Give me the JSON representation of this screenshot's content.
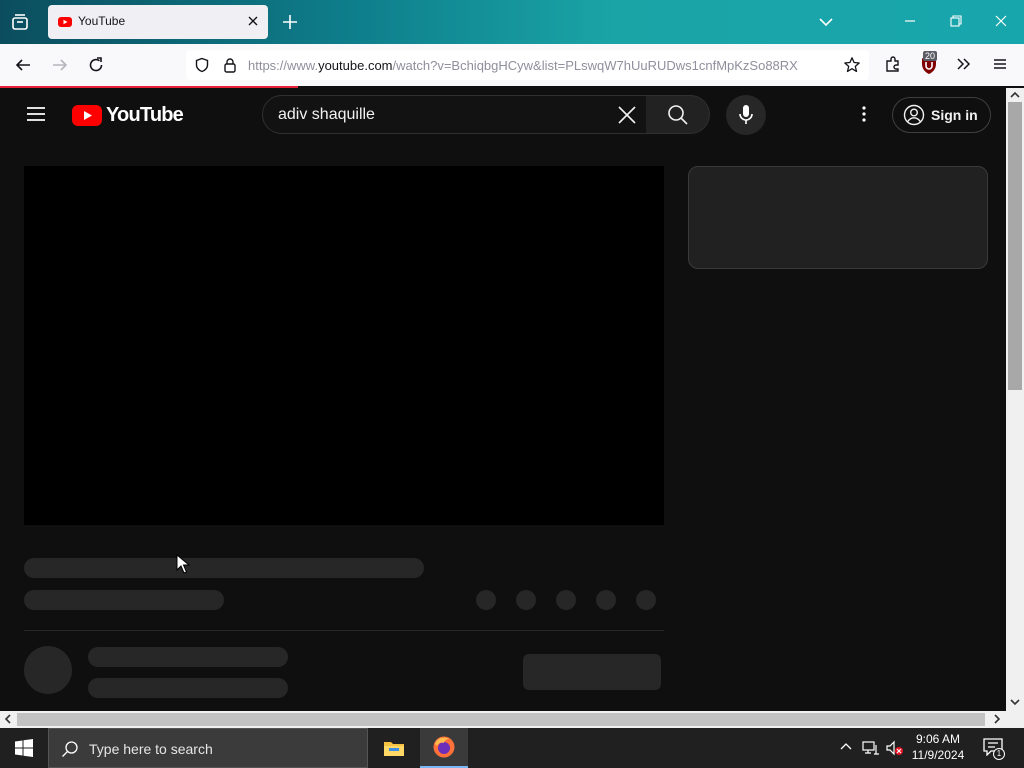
{
  "browser": {
    "tab": {
      "title": "YouTube"
    },
    "url": {
      "prefix": "https://www.",
      "domain": "youtube.com",
      "suffix": "/watch?v=BchiqbgHCyw&list=PLswqW7hUuRUDws1cnfMpKzSo88RX"
    },
    "ublock_count": "20"
  },
  "youtube": {
    "logo_text": "YouTube",
    "search": {
      "value": "adiv shaquille"
    },
    "sign_in_label": "Sign in"
  },
  "taskbar": {
    "search_placeholder": "Type here to search",
    "time": "9:06 AM",
    "date": "11/9/2024",
    "notification_count": "1"
  },
  "colors": {
    "accent_red": "#ff0000",
    "page_bg": "#0f0f0f",
    "skeleton": "#272727",
    "load_bar": "#e8203a"
  },
  "icons": [
    "tab-list-icon",
    "youtube-favicon",
    "close-icon",
    "plus-icon",
    "chevron-down-icon",
    "minimize-icon",
    "maximize-icon",
    "back-icon",
    "forward-icon",
    "reload-icon",
    "shield-icon",
    "lock-icon",
    "star-icon",
    "extensions-icon",
    "ublock-icon",
    "overflow-icon",
    "menu-icon",
    "hamburger-icon",
    "search-icon",
    "mic-icon",
    "more-vert-icon",
    "account-icon",
    "windows-icon",
    "file-explorer-icon",
    "firefox-icon"
  ]
}
